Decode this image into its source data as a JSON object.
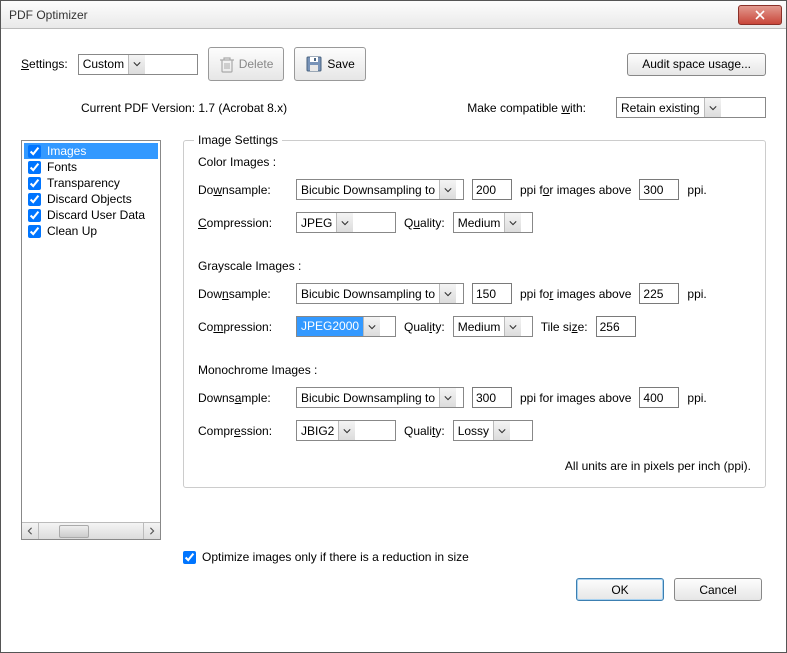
{
  "window": {
    "title": "PDF Optimizer"
  },
  "toolbar": {
    "settings_label": "Settings:",
    "settings_value": "Custom",
    "delete_label": "Delete",
    "save_label": "Save",
    "audit_label": "Audit space usage..."
  },
  "info": {
    "version_label": "Current PDF Version: 1.7 (Acrobat 8.x)",
    "compat_label": "Make compatible with:",
    "compat_value": "Retain existing"
  },
  "sidebar": {
    "items": [
      {
        "label": "Images",
        "checked": true,
        "selected": true
      },
      {
        "label": "Fonts",
        "checked": true,
        "selected": false
      },
      {
        "label": "Transparency",
        "checked": true,
        "selected": false
      },
      {
        "label": "Discard Objects",
        "checked": true,
        "selected": false
      },
      {
        "label": "Discard User Data",
        "checked": true,
        "selected": false
      },
      {
        "label": "Clean Up",
        "checked": true,
        "selected": false
      }
    ]
  },
  "panel": {
    "legend": "Image Settings",
    "color": {
      "title": "Color Images :",
      "downsample_label": "Downsample:",
      "downsample_method": "Bicubic Downsampling to",
      "ppi": "200",
      "ppi_txt1": "ppi for images above",
      "above": "300",
      "ppi_txt2": "ppi.",
      "compression_label": "Compression:",
      "compression_value": "JPEG",
      "quality_label": "Quality:",
      "quality_value": "Medium"
    },
    "gray": {
      "title": "Grayscale Images :",
      "downsample_label": "Downsample:",
      "downsample_method": "Bicubic Downsampling to",
      "ppi": "150",
      "ppi_txt1": "ppi for images above",
      "above": "225",
      "ppi_txt2": "ppi.",
      "compression_label": "Compression:",
      "compression_value": "JPEG2000",
      "quality_label": "Quality:",
      "quality_value": "Medium",
      "tile_label": "Tile size:",
      "tile_value": "256"
    },
    "mono": {
      "title": "Monochrome Images :",
      "downsample_label": "Downsample:",
      "downsample_method": "Bicubic Downsampling to",
      "ppi": "300",
      "ppi_txt1": "ppi for images above",
      "above": "400",
      "ppi_txt2": "ppi.",
      "compression_label": "Compression:",
      "compression_value": "JBIG2",
      "quality_label": "Quality:",
      "quality_value": "Lossy"
    },
    "units_note": "All units are in pixels per inch (ppi)."
  },
  "optimize_checkbox": {
    "checked": true,
    "label": "Optimize images only if there is a reduction in size"
  },
  "buttons": {
    "ok": "OK",
    "cancel": "Cancel"
  }
}
